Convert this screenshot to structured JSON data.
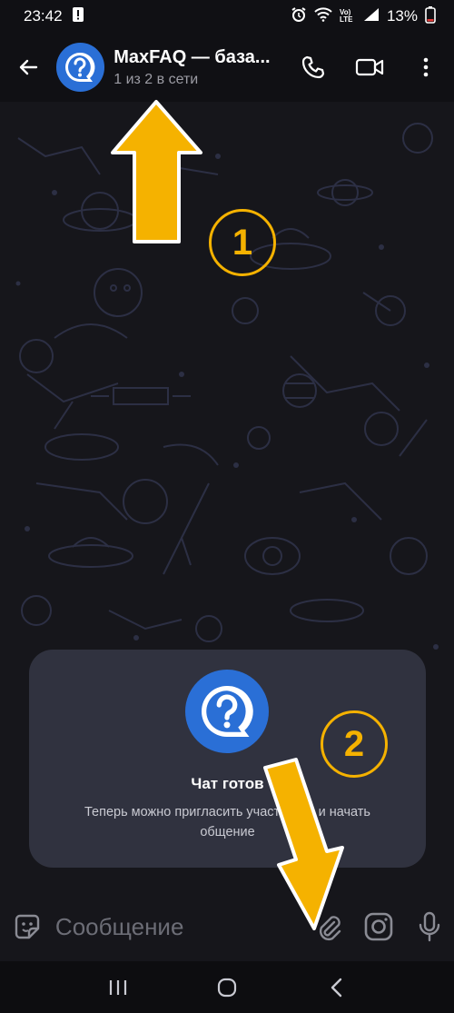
{
  "status_bar": {
    "time": "23:42",
    "battery": "13%",
    "network_label": "Vo) LTE",
    "icons": [
      "alert-icon",
      "alarm-icon",
      "wifi-icon",
      "signal-icon",
      "battery-icon"
    ]
  },
  "header": {
    "title": "MaxFAQ — база...",
    "subtitle": "1 из 2 в сети",
    "icons": [
      "back-arrow-icon",
      "question-avatar-icon",
      "phone-icon",
      "video-call-icon",
      "more-vert-icon"
    ]
  },
  "ready_card": {
    "title": "Чат готов",
    "text": "Теперь можно пригласить участников и начать общение"
  },
  "annotations": {
    "marker_1": "1",
    "marker_2": "2"
  },
  "composer": {
    "placeholder": "Сообщение",
    "icons": [
      "sticker-icon",
      "paperclip-icon",
      "camera-icon",
      "microphone-icon"
    ]
  },
  "nav_bar": {
    "icons": [
      "recent-apps-icon",
      "home-icon",
      "back-icon"
    ]
  },
  "colors": {
    "header_bg": "#101014",
    "chat_bg": "#16161b",
    "card_bg": "#30323f",
    "avatar_blue": "#2a6fd6",
    "annotation_yellow": "#f5b200",
    "subtitle_gray": "#9c9ca4"
  }
}
